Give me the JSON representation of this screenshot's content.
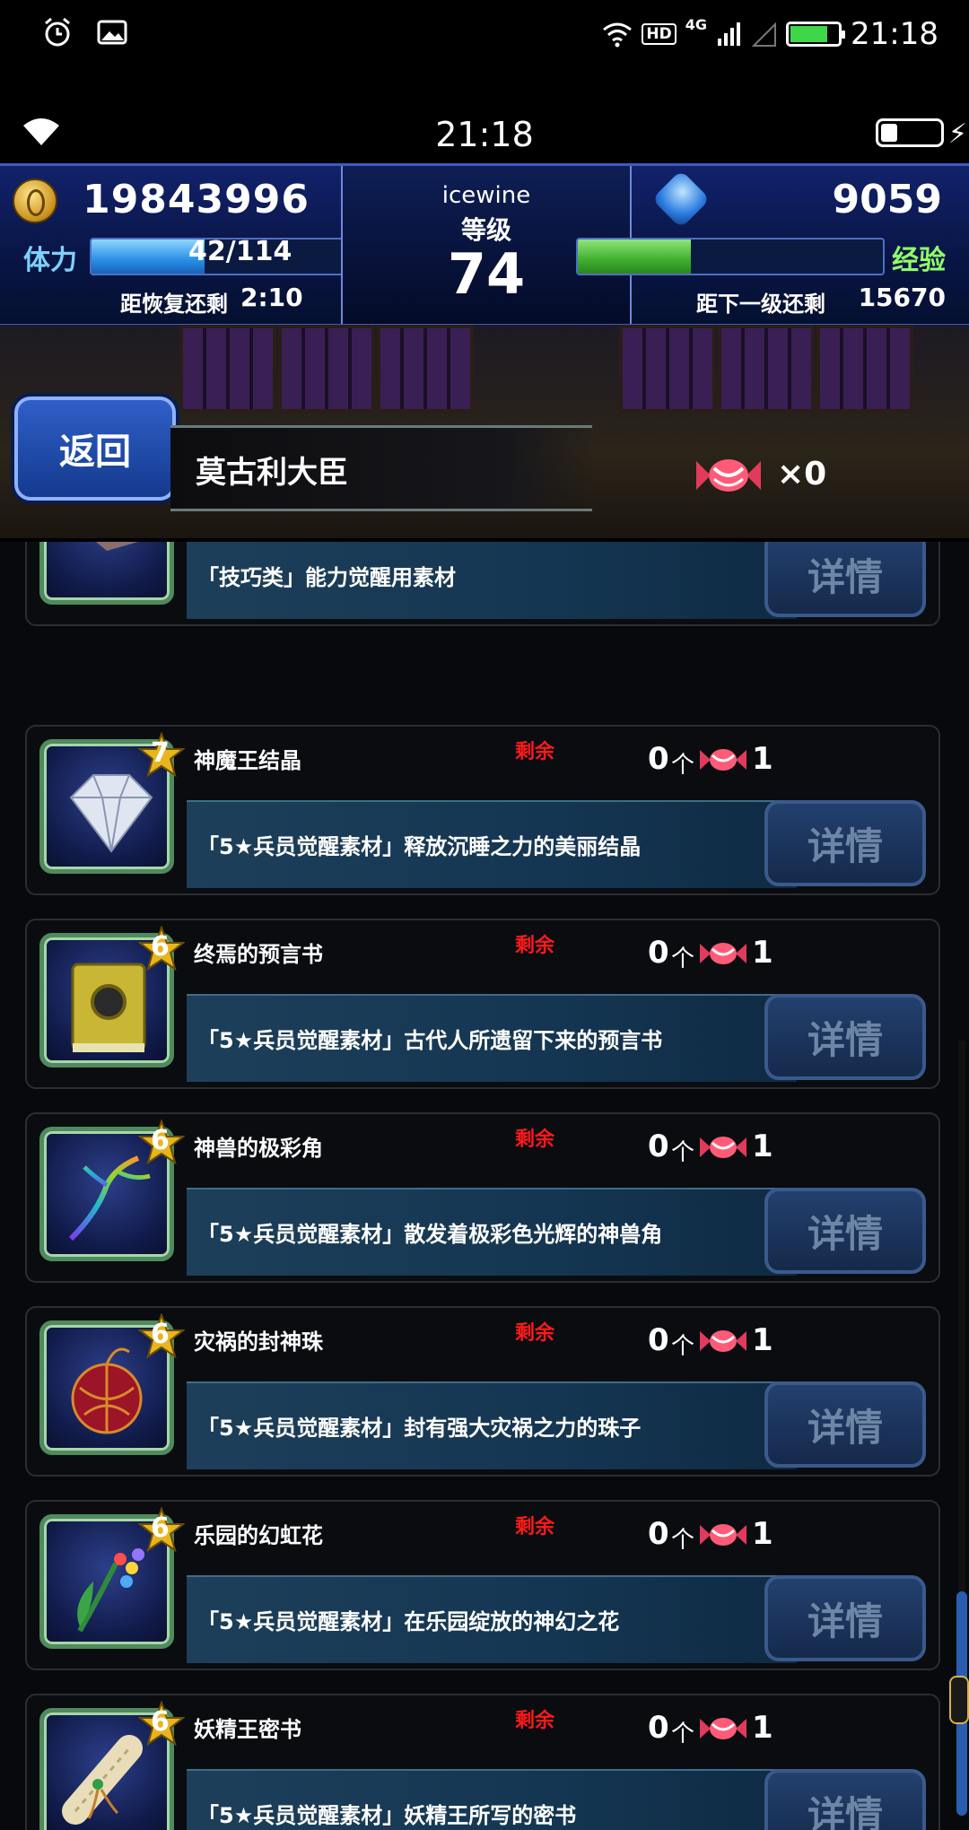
{
  "system_bar": {
    "time": "21:18",
    "network_badge": "HD",
    "network_type": "4G"
  },
  "game_bar": {
    "time": "21:18",
    "battery_level": 0.25
  },
  "player": {
    "gil": "19843996",
    "name": "icewine",
    "level_label": "等级",
    "level": "74",
    "lapis": "9059",
    "stamina_label": "体力",
    "stamina_text": "42/114",
    "stamina_fraction": 0.37,
    "recovery_label": "距恢复还剩",
    "recovery_time": "2:10",
    "exp_label": "经验",
    "exp_fraction": 0.37,
    "next_level_label": "距下一级还剩",
    "next_level_value": "15670"
  },
  "header": {
    "back_label": "返回",
    "title": "莫古利大臣",
    "candy_count": "×0"
  },
  "common": {
    "remain_label": "剩余",
    "unit": "个",
    "detail_label": "详情"
  },
  "items": [
    {
      "name": "",
      "rarity": "",
      "qty": "",
      "cost": "",
      "desc": "「技巧类」能力觉醒用素材",
      "icon": "ore-icon"
    },
    {
      "name": "神魔王结晶",
      "rarity": "7",
      "qty": "0",
      "cost": "1",
      "desc": "「5★兵员觉醒素材」释放沉睡之力的美丽结晶",
      "icon": "crystal-icon"
    },
    {
      "name": "终焉的预言书",
      "rarity": "6",
      "qty": "0",
      "cost": "1",
      "desc": "「5★兵员觉醒素材」古代人所遗留下来的预言书",
      "icon": "tome-icon"
    },
    {
      "name": "神兽的极彩角",
      "rarity": "6",
      "qty": "0",
      "cost": "1",
      "desc": "「5★兵员觉醒素材」散发着极彩色光辉的神兽角",
      "icon": "horn-icon"
    },
    {
      "name": "灾祸的封神珠",
      "rarity": "6",
      "qty": "0",
      "cost": "1",
      "desc": "「5★兵员觉醒素材」封有强大灾祸之力的珠子",
      "icon": "orb-icon"
    },
    {
      "name": "乐园的幻虹花",
      "rarity": "6",
      "qty": "0",
      "cost": "1",
      "desc": "「5★兵员觉醒素材」在乐园绽放的神幻之花",
      "icon": "flower-icon"
    },
    {
      "name": "妖精王密书",
      "rarity": "6",
      "qty": "0",
      "cost": "1",
      "desc": "「5★兵员觉醒素材」妖精王所写的密书",
      "icon": "scroll-icon"
    }
  ],
  "colors": {
    "remain_text": "#ff1a1a",
    "stamina_bar": "#2a8fe6",
    "exp_bar": "#3fae2f",
    "thumb_frame": "#4f8a5e"
  }
}
